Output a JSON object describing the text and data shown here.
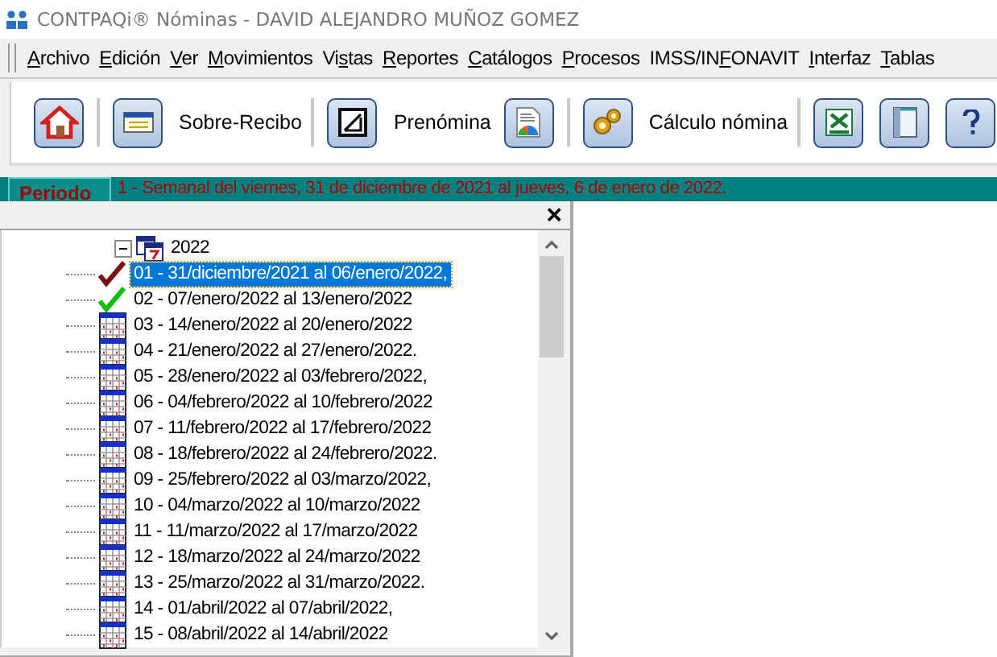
{
  "window": {
    "title": "CONTPAQi® Nóminas - DAVID ALEJANDRO MUÑOZ GOMEZ"
  },
  "menu": [
    {
      "key": "A",
      "post": "rchivo"
    },
    {
      "key": "E",
      "post": "dición"
    },
    {
      "key": "V",
      "post": "er"
    },
    {
      "key": "M",
      "post": "ovimientos"
    },
    {
      "pre": "Vi",
      "key": "s",
      "post": "tas"
    },
    {
      "key": "R",
      "post": "eportes"
    },
    {
      "key": "C",
      "post": "atálogos"
    },
    {
      "key": "P",
      "post": "rocesos"
    },
    {
      "pre": "IMSS/IN",
      "key": "F",
      "post": "ONAVIT"
    },
    {
      "key": "I",
      "post": "nterfaz"
    },
    {
      "key": "T",
      "post": "ablas"
    }
  ],
  "toolbar": [
    {
      "kind": "home"
    },
    {
      "kind": "separator"
    },
    {
      "kind": "receipt",
      "label": "Sobre-Recibo"
    },
    {
      "kind": "separator"
    },
    {
      "kind": "prenomina",
      "label": "Prenómina"
    },
    {
      "kind": "report"
    },
    {
      "kind": "separator"
    },
    {
      "kind": "gears",
      "label": "Cálculo nómina"
    },
    {
      "kind": "separator"
    },
    {
      "kind": "spreadsheet"
    },
    {
      "kind": "panel"
    },
    {
      "kind": "help"
    }
  ],
  "period": {
    "label": "Periodo",
    "value": "1 - Semanal del viernes, 31 de diciembre de 2021 al jueves, 6 de enero de 2022."
  },
  "panel": {
    "close": "×",
    "tree": [
      {
        "label": "2022",
        "kind": "year",
        "expanded": true,
        "selected": false,
        "children": [
          {
            "label": "01 - 31/diciembre/2021 al 06/enero/2022,",
            "kind": "closed",
            "selected": true
          },
          {
            "label": "02 - 07/enero/2022 al 13/enero/2022",
            "kind": "calculated",
            "selected": false
          },
          {
            "label": "03 - 14/enero/2022 al 20/enero/2022",
            "kind": "pending",
            "selected": false
          },
          {
            "label": "04 - 21/enero/2022 al 27/enero/2022.",
            "kind": "pending",
            "selected": false
          },
          {
            "label": "05 - 28/enero/2022 al 03/febrero/2022,",
            "kind": "pending",
            "selected": false
          },
          {
            "label": "06 - 04/febrero/2022 al 10/febrero/2022",
            "kind": "pending",
            "selected": false
          },
          {
            "label": "07 - 11/febrero/2022 al 17/febrero/2022",
            "kind": "pending",
            "selected": false
          },
          {
            "label": "08 - 18/febrero/2022 al 24/febrero/2022.",
            "kind": "pending",
            "selected": false
          },
          {
            "label": "09 - 25/febrero/2022 al 03/marzo/2022,",
            "kind": "pending",
            "selected": false
          },
          {
            "label": "10 - 04/marzo/2022 al 10/marzo/2022",
            "kind": "pending",
            "selected": false
          },
          {
            "label": "11 - 11/marzo/2022 al 17/marzo/2022",
            "kind": "pending",
            "selected": false
          },
          {
            "label": "12 - 18/marzo/2022 al 24/marzo/2022",
            "kind": "pending",
            "selected": false
          },
          {
            "label": "13 - 25/marzo/2022 al 31/marzo/2022.",
            "kind": "pending",
            "selected": false
          },
          {
            "label": "14 - 01/abril/2022 al 07/abril/2022,",
            "kind": "pending",
            "selected": false
          },
          {
            "label": "15 - 08/abril/2022 al 14/abril/2022",
            "kind": "pending",
            "selected": false
          }
        ]
      }
    ]
  }
}
